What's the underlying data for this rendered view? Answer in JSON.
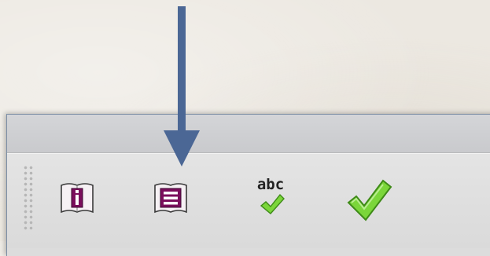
{
  "toolbar": {
    "buttons": [
      {
        "id": "info",
        "icon": "info-book-icon"
      },
      {
        "id": "contents",
        "icon": "list-book-icon"
      },
      {
        "id": "spellcheck",
        "icon": "abc-check-icon",
        "label": "abc"
      },
      {
        "id": "validate",
        "icon": "checkmark-icon"
      }
    ]
  },
  "annotation": {
    "icon": "down-arrow-icon",
    "color": "#4b6795",
    "target": "contents"
  },
  "colors": {
    "book_accent": "#7b0e5c",
    "check_green": "#6fcf2a",
    "window_border": "#7d8fa6"
  }
}
